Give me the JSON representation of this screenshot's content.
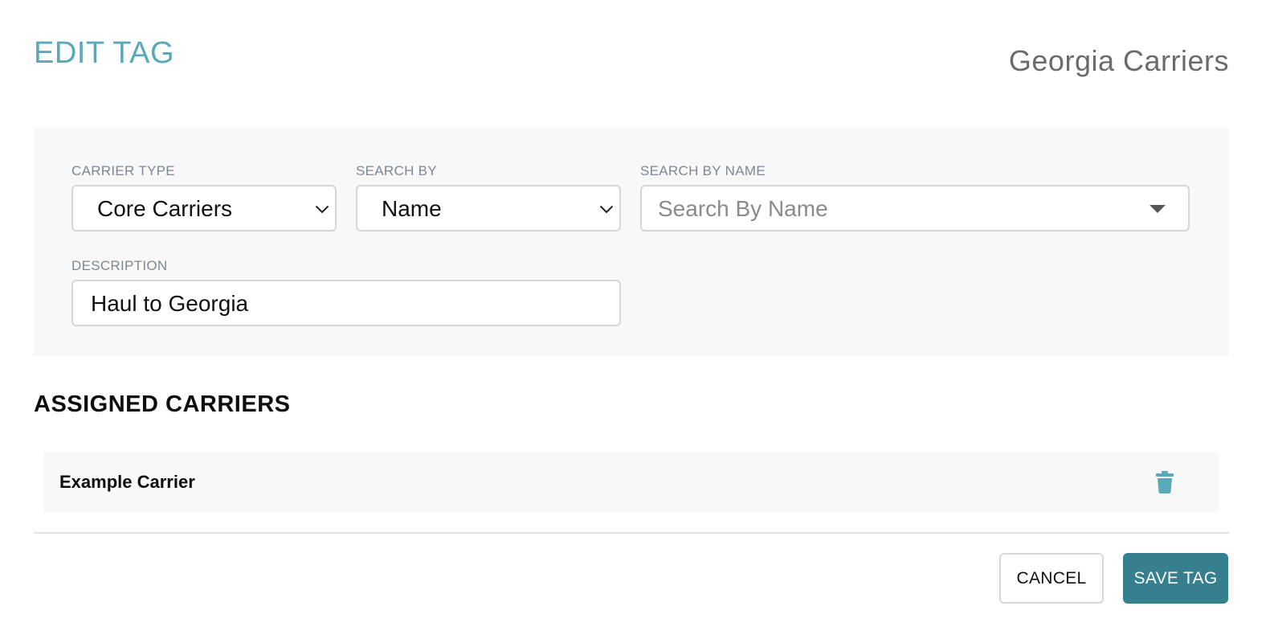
{
  "header": {
    "title": "EDIT TAG",
    "tag_name": "Georgia Carriers"
  },
  "filters": {
    "carrier_type": {
      "label": "CARRIER TYPE",
      "value": "Core Carriers"
    },
    "search_by": {
      "label": "SEARCH BY",
      "value": "Name"
    },
    "search_by_name": {
      "label": "SEARCH BY NAME",
      "placeholder": "Search By Name"
    },
    "description": {
      "label": "DESCRIPTION",
      "value": "Haul to Georgia"
    }
  },
  "assigned": {
    "heading": "ASSIGNED CARRIERS",
    "carriers": [
      {
        "name": "Example Carrier",
        "action_icon": "trash-icon"
      }
    ]
  },
  "footer": {
    "cancel_label": "CANCEL",
    "save_label": "SAVE TAG"
  },
  "colors": {
    "accent": "#5aa9b9",
    "primary_button": "#357f8f",
    "panel_bg": "#f8f8f8",
    "label": "#7c8893"
  }
}
